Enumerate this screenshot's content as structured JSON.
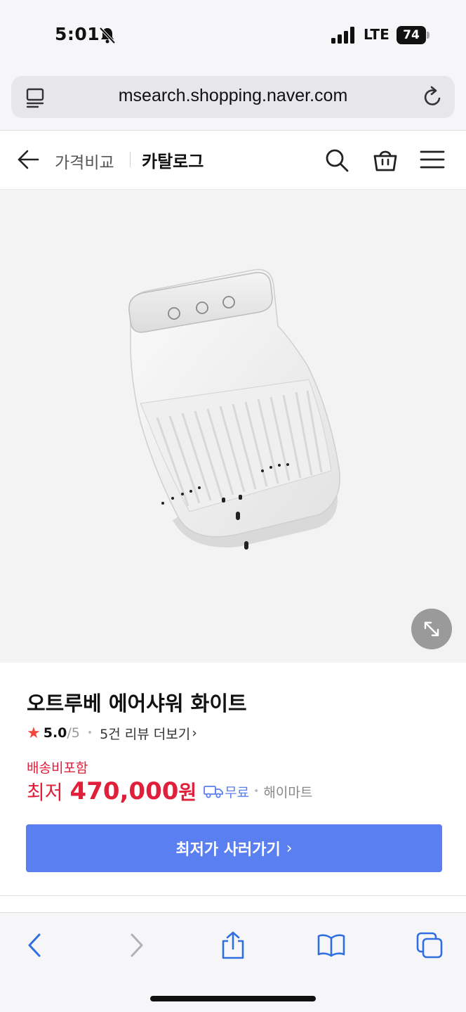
{
  "status_bar": {
    "time": "5:01",
    "network": "LTE",
    "battery": "74"
  },
  "browser": {
    "url": "msearch.shopping.naver.com"
  },
  "header": {
    "crumb_price_compare": "가격비교",
    "crumb_catalog": "카탈로그"
  },
  "product": {
    "title": "오트루베 에어샤워 화이트",
    "rating": "5.0",
    "rating_max": "/5",
    "review_link": "5건 리뷰 더보기",
    "shipping_label": "배송비포함",
    "price_prefix": "최저",
    "price": "470,000",
    "price_unit": "원",
    "shipping_fee": "무료",
    "seller": "해이마트"
  },
  "cta": {
    "buy_label": "최저가 사러가기"
  },
  "colors": {
    "accent_blue": "#5a7ff0",
    "price_red": "#e0203b",
    "star_red": "#f2453d"
  }
}
